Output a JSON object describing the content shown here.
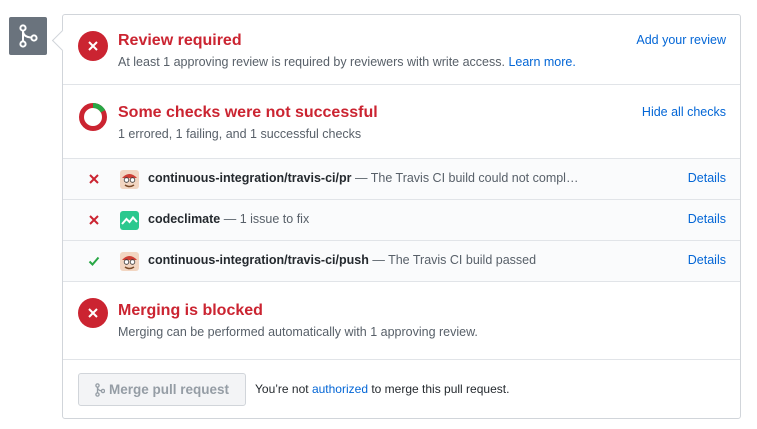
{
  "review": {
    "title": "Review required",
    "description": "At least 1 approving review is required by reviewers with write access.",
    "learn_more": "Learn more.",
    "action": "Add your review"
  },
  "checks": {
    "title": "Some checks were not successful",
    "summary": "1 errored, 1 failing, and 1 successful checks",
    "action": "Hide all checks",
    "items": [
      {
        "status": "failed",
        "name": "continuous-integration/travis-ci/pr",
        "message": "— The Travis CI build could not compl…",
        "details": "Details",
        "avatar_icon": "travis-ci-mascot-icon"
      },
      {
        "status": "failed",
        "name": "codeclimate",
        "message": "— 1 issue to fix",
        "details": "Details",
        "avatar_icon": "codeclimate-logo-icon"
      },
      {
        "status": "success",
        "name": "continuous-integration/travis-ci/push",
        "message": "— The Travis CI build passed",
        "details": "Details",
        "avatar_icon": "travis-ci-mascot-icon"
      }
    ]
  },
  "merge_status": {
    "title": "Merging is blocked",
    "description": "Merging can be performed automatically with 1 approving review."
  },
  "merge_footer": {
    "button_label": "Merge pull request",
    "note_prefix": "You’re not",
    "note_link": "authorized",
    "note_suffix": "to merge this pull request."
  },
  "colors": {
    "error_red": "#cb2431",
    "success_green": "#28a745",
    "link_blue": "#0366d6"
  }
}
